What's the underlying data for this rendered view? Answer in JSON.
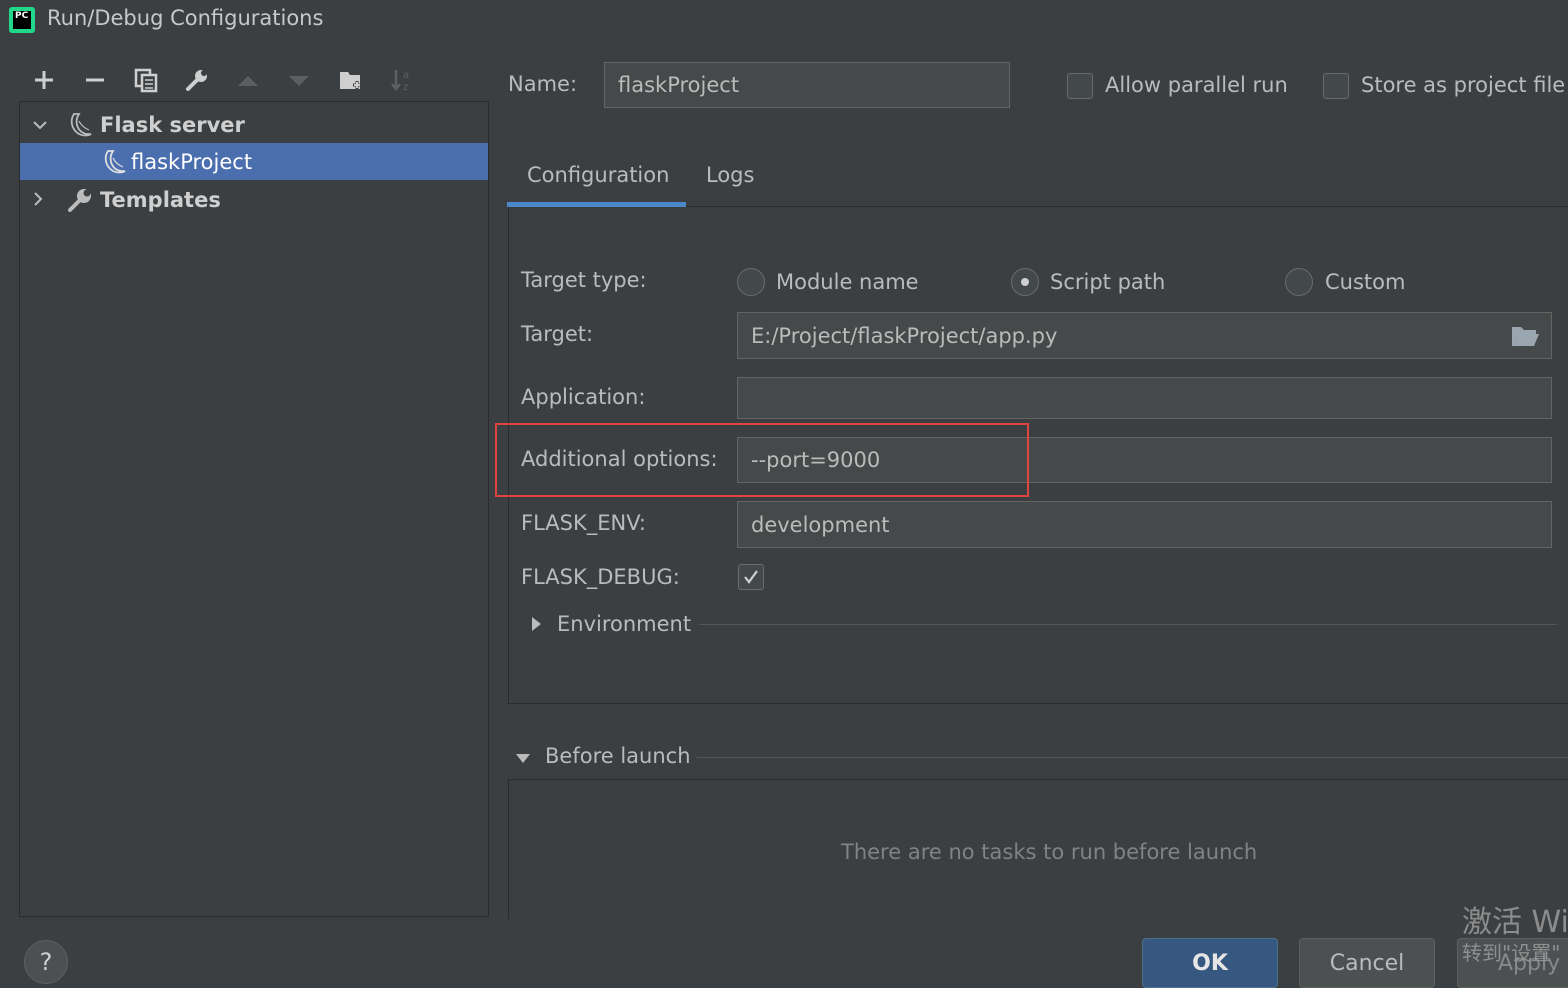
{
  "window": {
    "title": "Run/Debug Configurations",
    "logo_text": "PC"
  },
  "tree": {
    "group_label": "Flask server",
    "item_label": "flaskProject",
    "templates_label": "Templates"
  },
  "form": {
    "name_label": "Name:",
    "name_value": "flaskProject",
    "allow_parallel_label": "Allow parallel run",
    "store_project_label": "Store as project file",
    "tabs": [
      "Configuration",
      "Logs"
    ],
    "target_type_label": "Target type:",
    "target_type_options": [
      "Module name",
      "Script path",
      "Custom"
    ],
    "target_type_selected": "Script path",
    "target_label": "Target:",
    "target_value": "E:/Project/flaskProject/app.py",
    "application_label": "Application:",
    "application_value": "",
    "additional_options_label": "Additional options:",
    "additional_options_value": "--port=9000",
    "flask_env_label": "FLASK_ENV:",
    "flask_env_value": "development",
    "flask_debug_label": "FLASK_DEBUG:",
    "flask_debug_checked": true,
    "environment_label": "Environment"
  },
  "before_launch": {
    "label": "Before launch",
    "empty_text": "There are no tasks to run before launch"
  },
  "buttons": {
    "ok": "OK",
    "cancel": "Cancel",
    "apply": "Apply",
    "help": "?"
  },
  "watermark": {
    "line1": "激活 Wi",
    "line2": "转到\"设置\""
  },
  "colors": {
    "selection": "#4b6eaf",
    "accent": "#4a88c7",
    "highlight_box": "#e0443e",
    "ok_button": "#365880"
  }
}
